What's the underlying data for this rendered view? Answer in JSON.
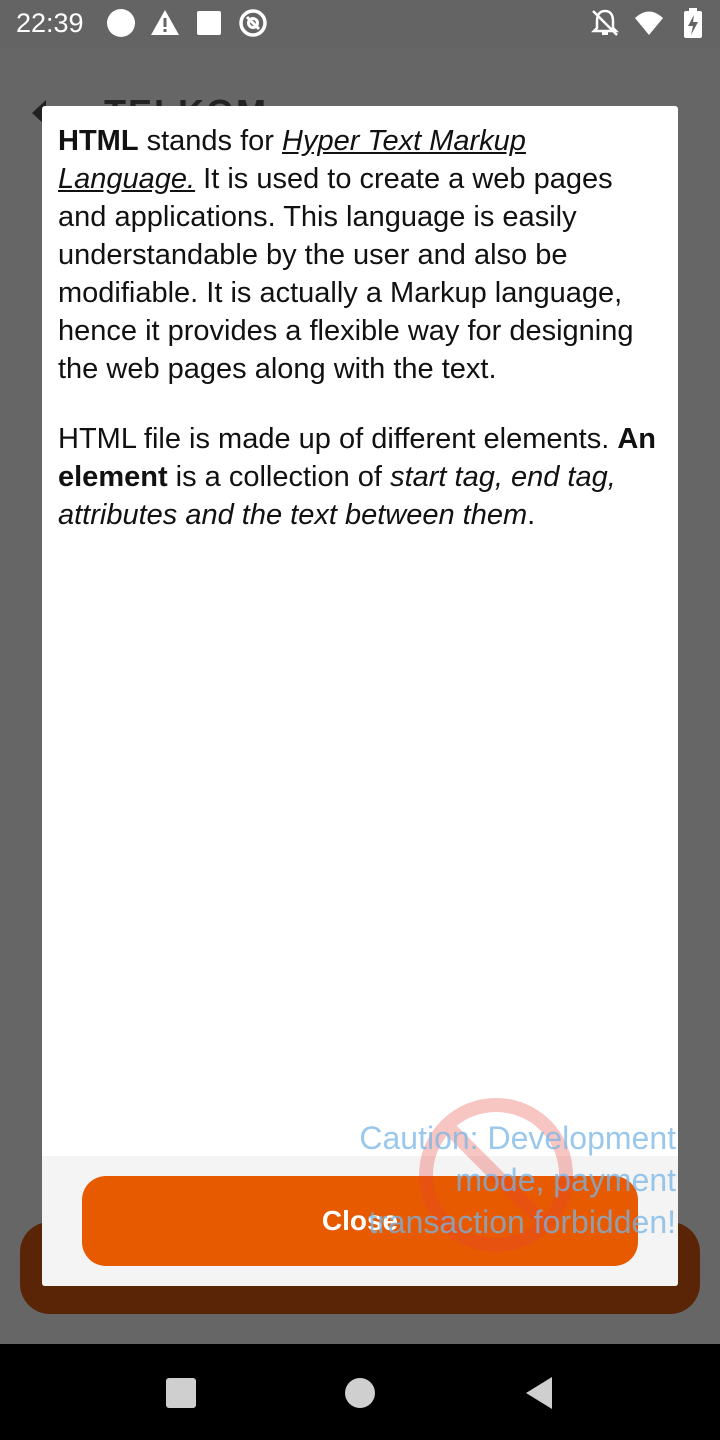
{
  "status_bar": {
    "time": "22:39",
    "left_icons": [
      "circle-icon",
      "warning-icon",
      "square-icon",
      "at-icon"
    ],
    "right_icons": [
      "notifications-off-icon",
      "wifi-icon",
      "battery-charging-icon"
    ]
  },
  "background_app": {
    "title": "TELKOM"
  },
  "dialog": {
    "p1": {
      "bold": "HTML",
      "t1": " stands for ",
      "link": "Hyper Text Markup Language.",
      "t2": " It is used to create a web pages and applications. This language is easily understandable by the user and also be modifiable. It is actually a Markup language, hence it provides a flexible way for designing the web pages along with the text."
    },
    "p2": {
      "t1": "HTML file is made up of different elements. ",
      "bold": "An element",
      "t2": " is a collection of ",
      "italic": "start tag, end tag, attributes and the text between them",
      "t3": "."
    },
    "close_label": "Close"
  },
  "watermark": {
    "text": "Caution: Development mode, payment transaction forbidden!"
  },
  "colors": {
    "accent": "#e85a00",
    "scrim": "#666666",
    "bg_button": "#5a2506"
  },
  "nav_bar": {
    "icons": [
      "recents-icon",
      "home-icon",
      "back-icon"
    ]
  }
}
